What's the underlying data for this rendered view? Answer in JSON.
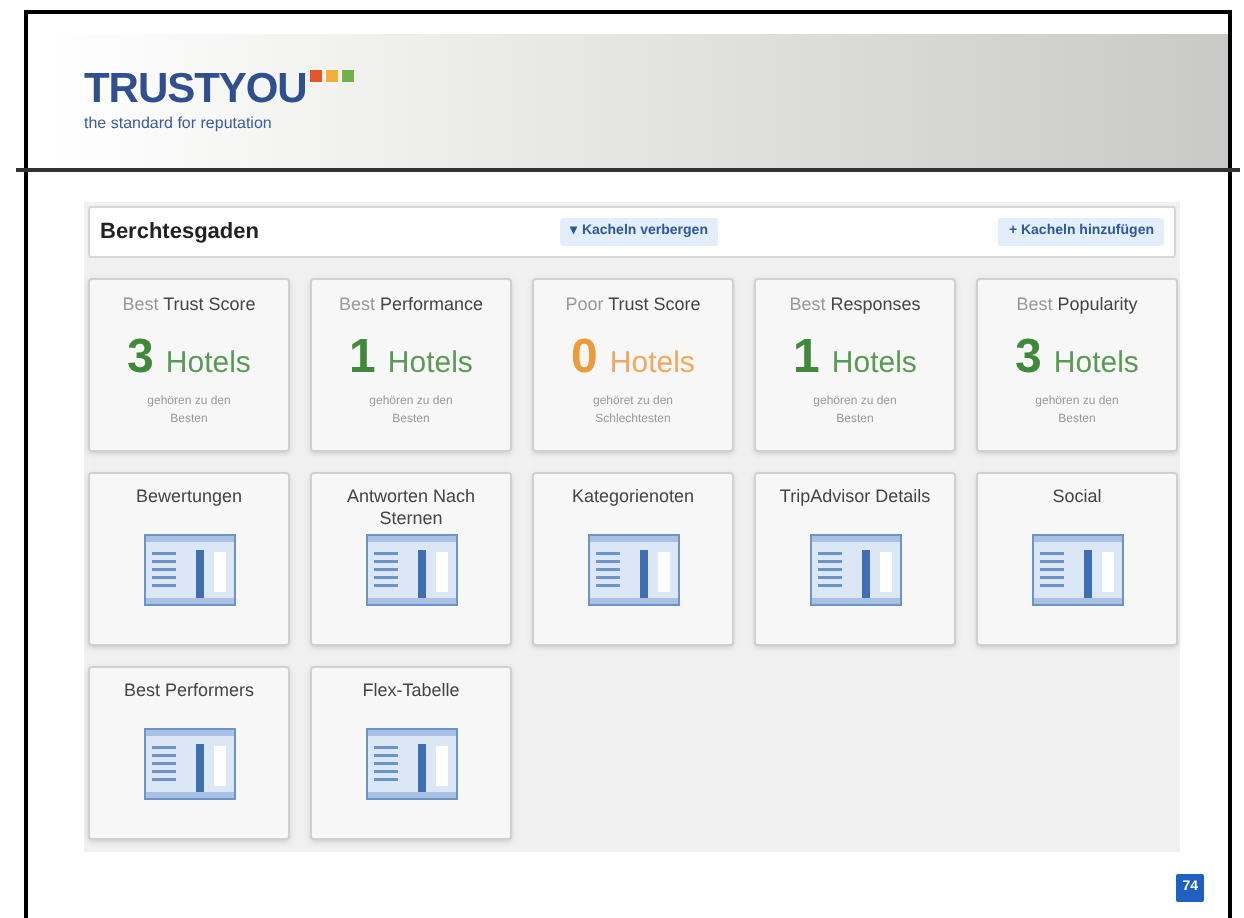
{
  "logo": {
    "name": "TRUSTYOU",
    "tagline": "the standard for reputation"
  },
  "panel": {
    "title": "Berchtesgaden",
    "hide_button": {
      "icon": "▾",
      "label": "Kacheln verbergen"
    },
    "add_button": {
      "icon": "+",
      "label": "Kacheln hinzufügen"
    }
  },
  "score_tiles": [
    {
      "prefix": "Best",
      "label": "Trust Score",
      "count": "3",
      "unit": "Hotels",
      "note": "gehören zu den Besten",
      "kind": "best"
    },
    {
      "prefix": "Best",
      "label": "Performance",
      "count": "1",
      "unit": "Hotels",
      "note": "gehören zu den Besten",
      "kind": "best"
    },
    {
      "prefix": "Poor",
      "label": "Trust Score",
      "count": "0",
      "unit": "Hotels",
      "note": "gehöret zu den Schlechtesten",
      "kind": "poor"
    },
    {
      "prefix": "Best",
      "label": "Responses",
      "count": "1",
      "unit": "Hotels",
      "note": "gehören zu den Besten",
      "kind": "best"
    },
    {
      "prefix": "Best",
      "label": "Popularity",
      "count": "3",
      "unit": "Hotels",
      "note": "gehören zu den Besten",
      "kind": "best"
    }
  ],
  "widget_tiles": [
    {
      "label": "Bewertungen"
    },
    {
      "label": "Antworten Nach Sternen"
    },
    {
      "label": "Kategorienoten"
    },
    {
      "label": "TripAdvisor Details"
    },
    {
      "label": "Social"
    },
    {
      "label": "Best Performers"
    },
    {
      "label": "Flex-Tabelle"
    }
  ],
  "page_number": "74"
}
